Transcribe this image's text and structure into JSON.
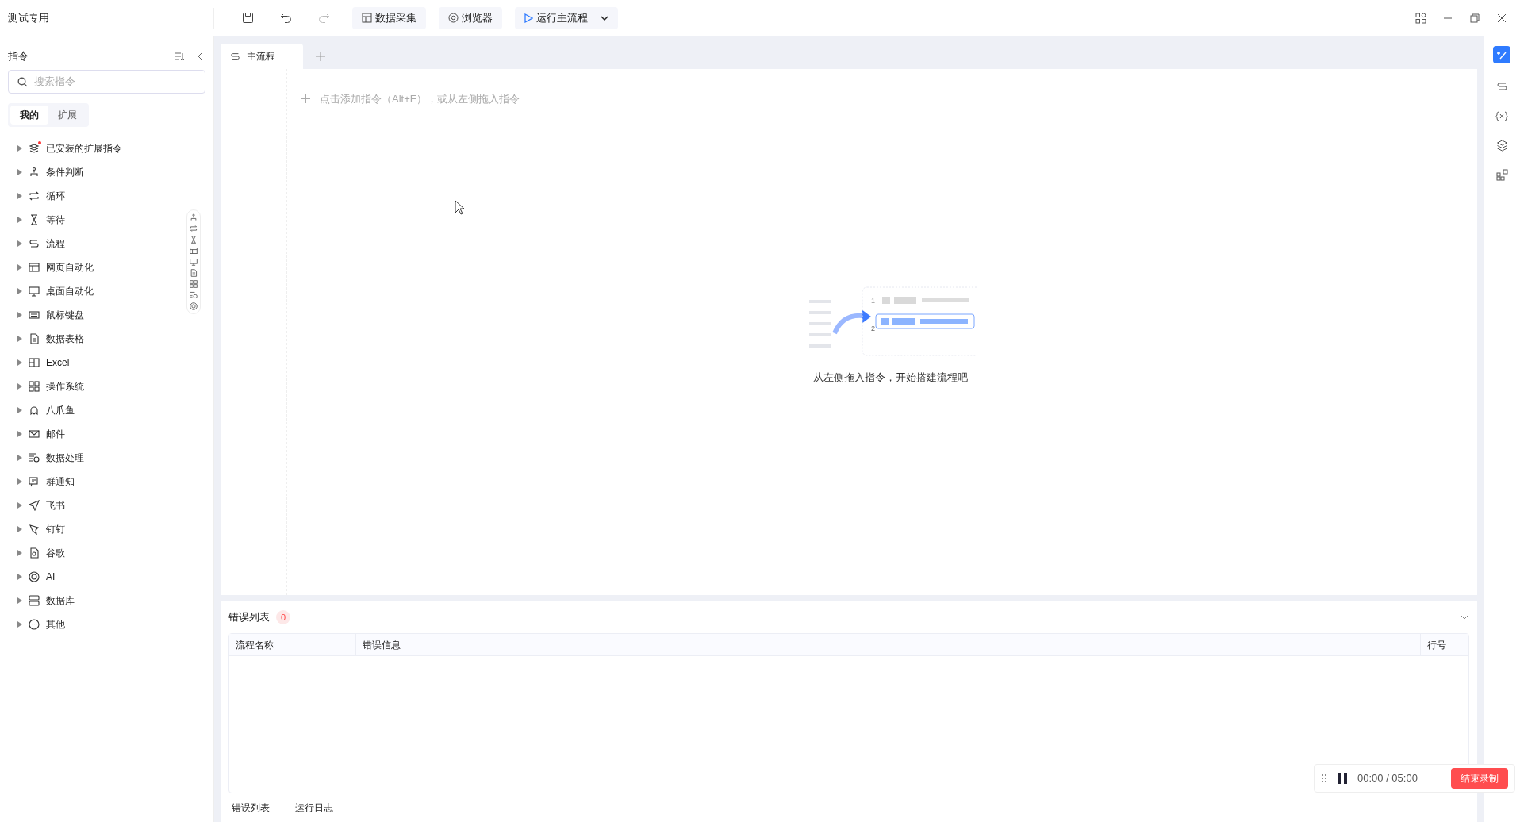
{
  "window": {
    "title": "测试专用"
  },
  "toolbar": [
    {
      "kind": "save"
    },
    {
      "kind": "undo",
      "disabled": false
    },
    {
      "kind": "redo",
      "disabled": true
    },
    {
      "kind": "text",
      "label": "数据采集"
    },
    {
      "kind": "text",
      "label": "浏览器"
    },
    {
      "kind": "run",
      "label": "运行主流程"
    }
  ],
  "sidebar": {
    "title": "指令",
    "search": {
      "placeholder": "搜索指令"
    },
    "tabs": [
      {
        "label": "我的",
        "selected": true
      },
      {
        "label": "扩展",
        "selected": false
      }
    ],
    "items": [
      {
        "label": "已安装的扩展指令",
        "expanded": false,
        "notification": true
      },
      {
        "label": "条件判断",
        "expanded": false,
        "notification": false
      },
      {
        "label": "循环",
        "expanded": false,
        "notification": false
      },
      {
        "label": "等待",
        "expanded": false,
        "notification": false
      },
      {
        "label": "流程",
        "expanded": false,
        "notification": false
      },
      {
        "label": "网页自动化",
        "expanded": false,
        "notification": false
      },
      {
        "label": "桌面自动化",
        "expanded": false,
        "notification": false
      },
      {
        "label": "鼠标键盘",
        "expanded": false,
        "notification": false
      },
      {
        "label": "数据表格",
        "expanded": false,
        "notification": false
      },
      {
        "label": "Excel",
        "expanded": false,
        "notification": false
      },
      {
        "label": "操作系统",
        "expanded": false,
        "notification": false
      },
      {
        "label": "八爪鱼",
        "expanded": false,
        "notification": false
      },
      {
        "label": "邮件",
        "expanded": false,
        "notification": false
      },
      {
        "label": "数据处理",
        "expanded": false,
        "notification": false
      },
      {
        "label": "群通知",
        "expanded": false,
        "notification": false
      },
      {
        "label": "飞书",
        "expanded": false,
        "notification": false
      },
      {
        "label": "钉钉",
        "expanded": false,
        "notification": false
      },
      {
        "label": "谷歌",
        "expanded": false,
        "notification": false
      },
      {
        "label": "AI",
        "expanded": false,
        "notification": false
      },
      {
        "label": "数据库",
        "expanded": false,
        "notification": false
      },
      {
        "label": "其他",
        "expanded": false,
        "notification": false
      }
    ]
  },
  "editor": {
    "tabs": [
      {
        "label": "主流程",
        "selected": true
      }
    ],
    "add_hint": "点击添加指令（Alt+F），或从左侧拖入指令",
    "empty_text": "从左侧拖入指令，开始搭建流程吧",
    "illustration_numbers": [
      "1",
      "2"
    ]
  },
  "error_panel": {
    "title": "错误列表",
    "count": "0",
    "columns": [
      "流程名称",
      "错误信息",
      "行号"
    ],
    "bottom_tabs": [
      {
        "label": "错误列表"
      },
      {
        "label": "运行日志"
      }
    ]
  },
  "recorder": {
    "time": "00:00 / 05:00",
    "stop_label": "结束录制"
  }
}
